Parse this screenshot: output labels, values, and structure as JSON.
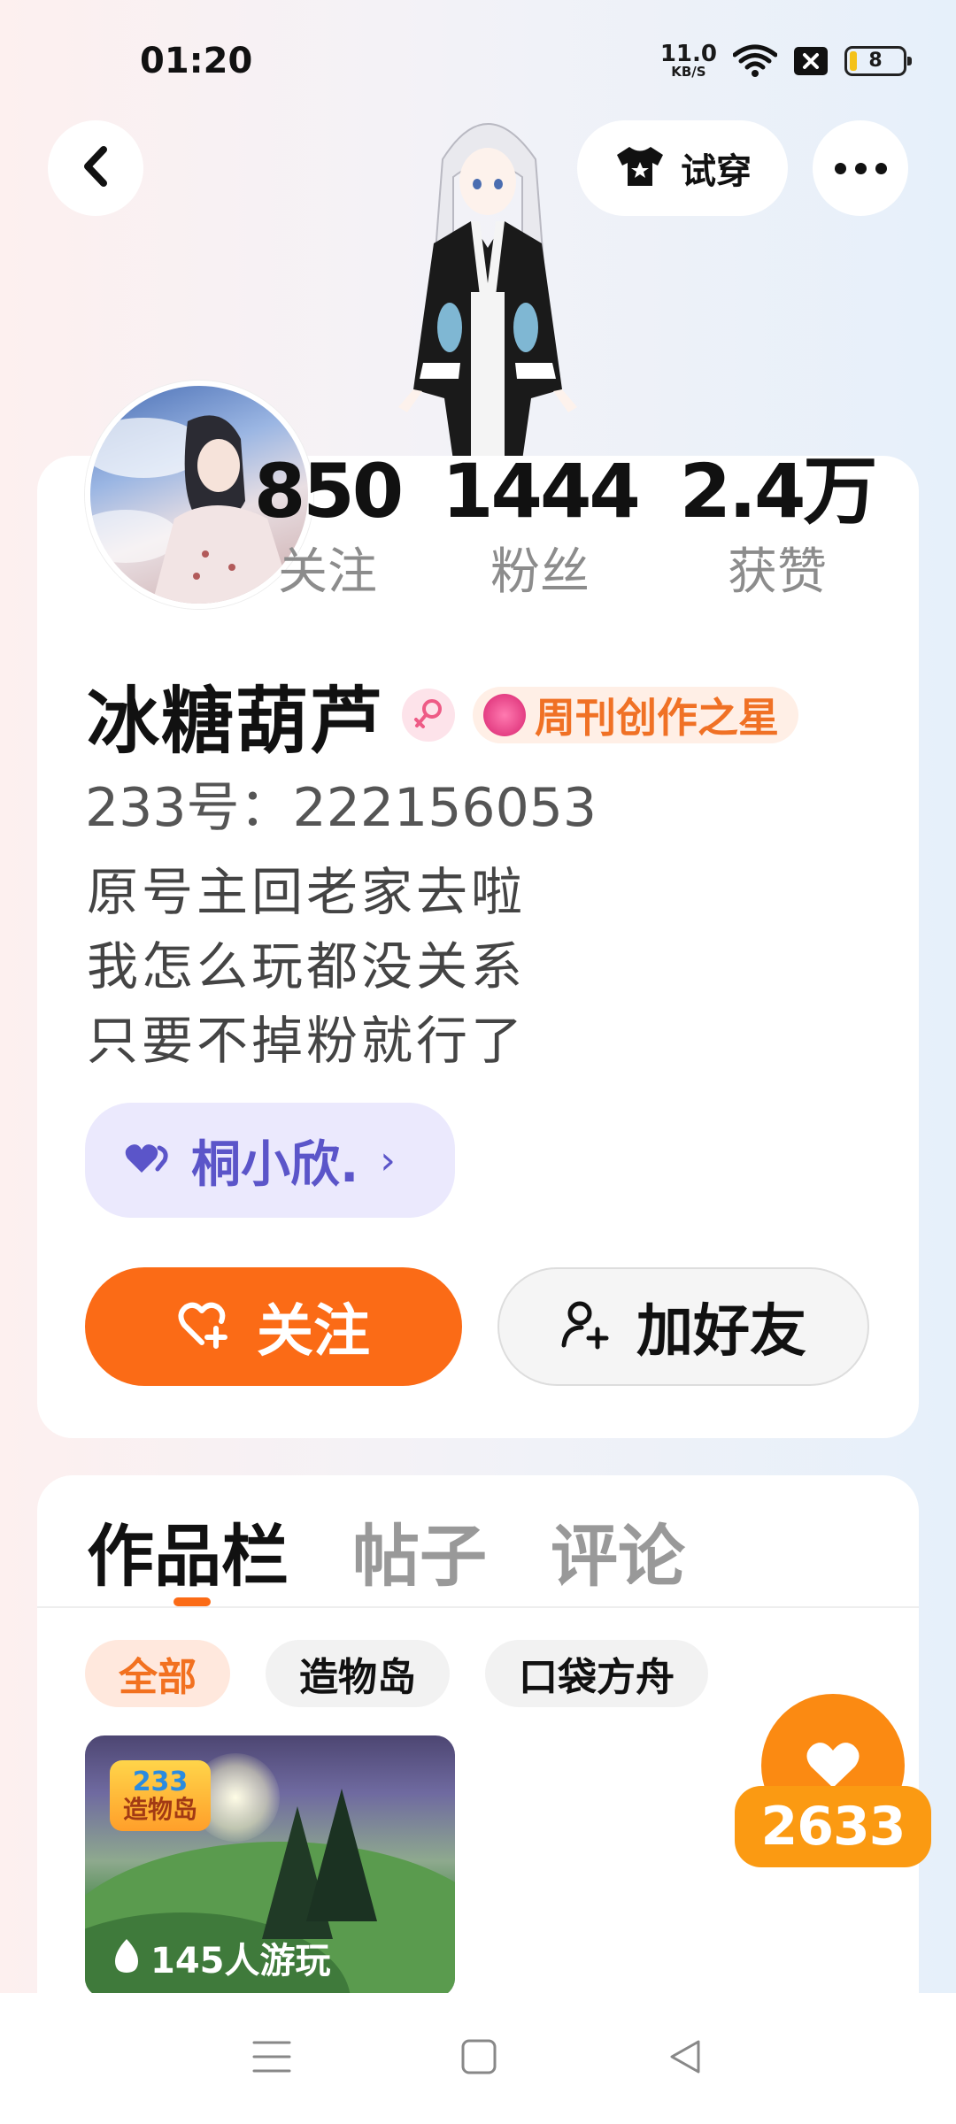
{
  "status_bar": {
    "time": "01:20",
    "net_speed_value": "11.0",
    "net_speed_unit": "KB/S",
    "battery_level": "8",
    "icons": [
      "wifi-icon",
      "sim-disabled-icon",
      "battery-icon"
    ]
  },
  "header": {
    "back_icon": "chevron-left-icon",
    "try_on_label": "试穿",
    "try_on_icon": "tshirt-icon",
    "more_icon": "more-horizontal-icon"
  },
  "profile": {
    "stats": [
      {
        "value": "850",
        "label": "关注"
      },
      {
        "value": "1444",
        "label": "粉丝"
      },
      {
        "value": "2.4万",
        "label": "获赞"
      }
    ],
    "name": "冰糖葫芦",
    "gender_icon": "female-icon",
    "honor_badge": "周刊创作之星",
    "user_id": "233号：222156053",
    "bio_lines": [
      "原号主回老家去啦",
      "我怎么玩都没关系",
      "只要不掉粉就行了"
    ],
    "partner": {
      "icon": "hearts-icon",
      "name": "桐小欣.",
      "chevron": "›"
    },
    "follow_label": "关注",
    "add_friend_label": "加好友"
  },
  "content": {
    "tabs": [
      {
        "label": "作品栏",
        "active": true
      },
      {
        "label": "帖子",
        "active": false
      },
      {
        "label": "评论",
        "active": false
      }
    ],
    "filters": [
      {
        "label": "全部",
        "active": true
      },
      {
        "label": "造物岛",
        "active": false
      },
      {
        "label": "口袋方舟",
        "active": false
      }
    ],
    "works": [
      {
        "logo_line1": "233",
        "logo_line2": "造物岛",
        "play_count": "145人游玩"
      }
    ]
  },
  "like_float": {
    "count": "2633",
    "icon": "heart-icon"
  },
  "nav_bar": {
    "icons": [
      "menu-icon",
      "home-square-icon",
      "back-triangle-icon"
    ]
  },
  "colors": {
    "accent_orange": "#fb6b16",
    "partner_purple": "#5b55c9",
    "honor_orange": "#f07125"
  }
}
